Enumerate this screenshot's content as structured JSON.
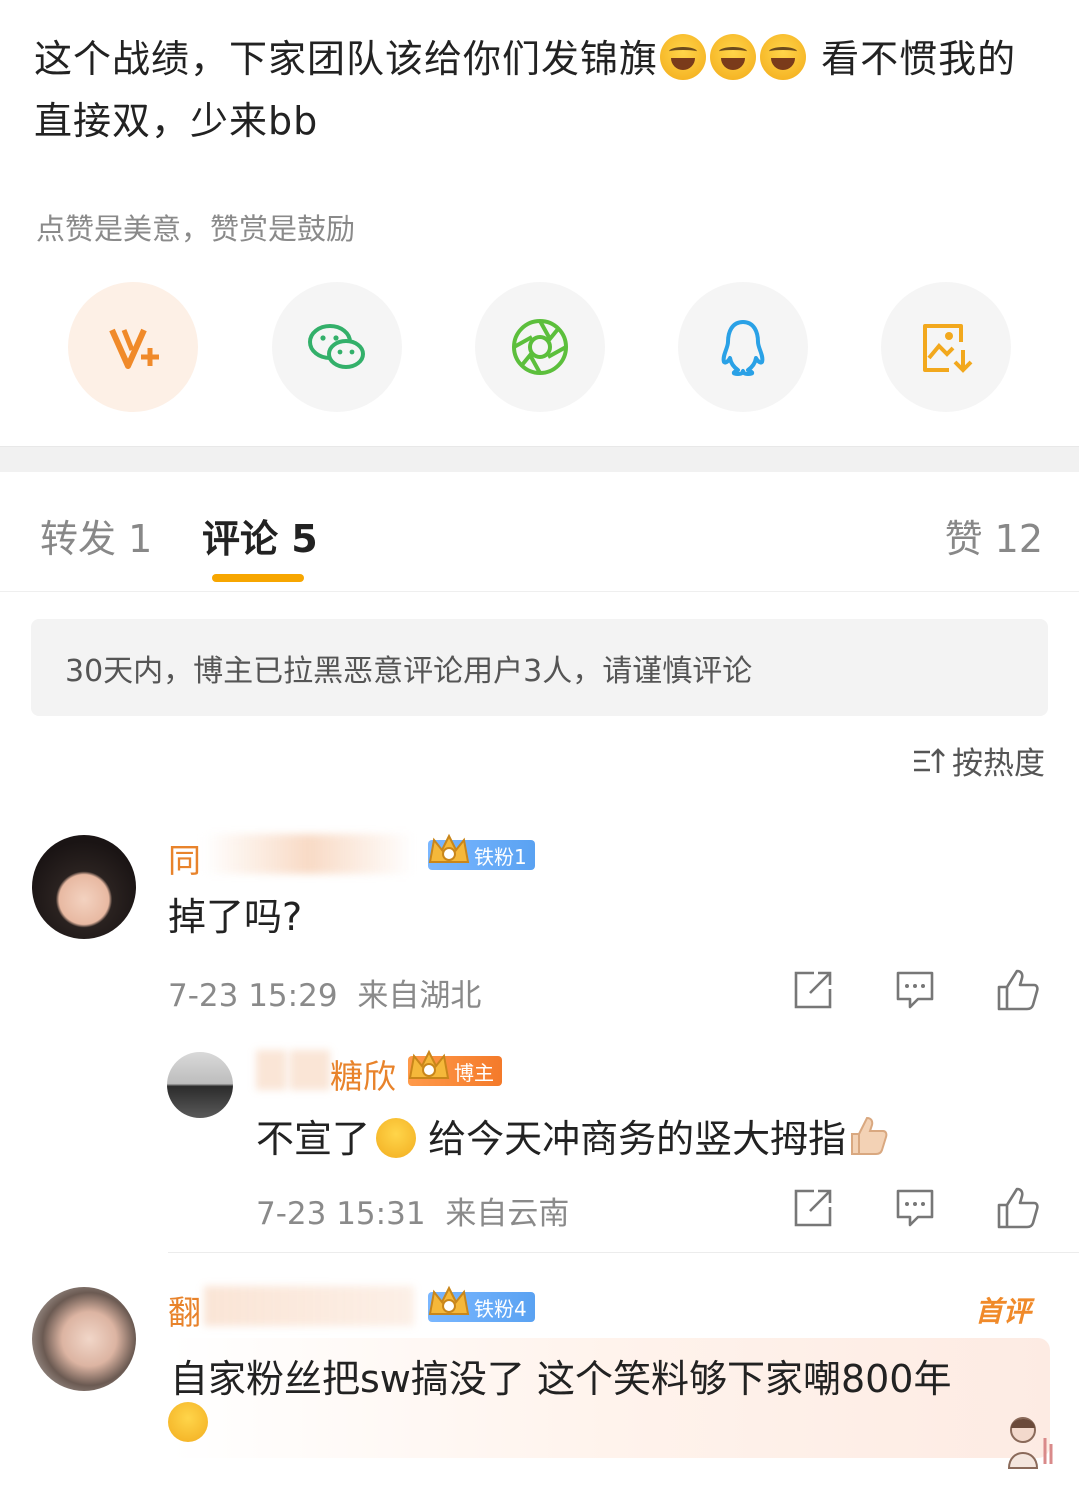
{
  "post": {
    "text_line1": "这个战绩，下家团队该给你们发锦旗",
    "text_line1_suffix": " 看不惯我的",
    "text_line2": "直接双，少来bb",
    "reward_hint": "点赞是美意，赞赏是鼓励"
  },
  "share": {
    "items": [
      {
        "icon": "vplus-icon",
        "color": "#f08a2a"
      },
      {
        "icon": "wechat-icon",
        "color": "#33b06a"
      },
      {
        "icon": "moments-icon",
        "color": "#5cbf3c"
      },
      {
        "icon": "qq-icon",
        "color": "#2aa1e6"
      },
      {
        "icon": "save-image-icon",
        "color": "#f2a81d"
      }
    ]
  },
  "tabs": {
    "repost": "转发 1",
    "comments": "评论 5",
    "likes": "赞 12"
  },
  "notice": "30天内，博主已拉黑恶意评论用户3人，请谨慎评论",
  "sort_label": "按热度",
  "comments": [
    {
      "username": "同",
      "badge": "铁粉1",
      "text": "掉了吗?",
      "time": "7-23 15:29",
      "location": "来自湖北"
    },
    {
      "username": "糖欣",
      "badge": "博主",
      "text_a": "不宣了",
      "text_b": "  给今天冲商务的竖大拇指",
      "time": "7-23 15:31",
      "location": "来自云南"
    },
    {
      "username": "翻",
      "badge": "铁粉4",
      "first_tag": "首评",
      "text": "自家粉丝把sw搞没了 这个笑料够下家嘲800年"
    }
  ],
  "colors": {
    "accent": "#f7a600",
    "username": "#e8832b"
  }
}
